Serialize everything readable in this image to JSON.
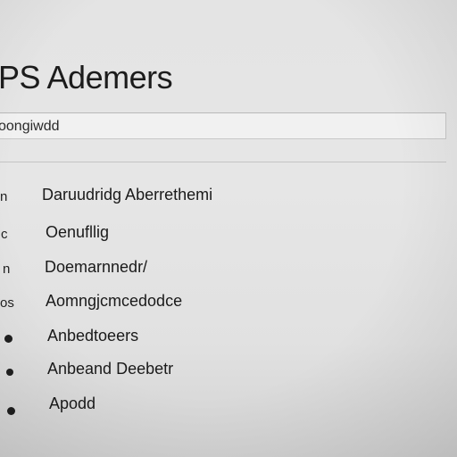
{
  "header": {
    "title": "PS Ademers"
  },
  "search": {
    "value": "oongiwdd"
  },
  "menu": {
    "items": [
      {
        "marker": "n",
        "label": "Daruudridg Aberrethemi"
      },
      {
        "marker": "c",
        "label": "Oenufllig"
      },
      {
        "marker": "n",
        "label": "Doemarnnedr/"
      },
      {
        "marker": "os",
        "label": "Aomngjcmcedodce"
      },
      {
        "marker": "",
        "label": "Anbedtoeers"
      },
      {
        "marker": "",
        "label": "Anbeand Deebetr"
      },
      {
        "marker": "",
        "label": "Apodd"
      }
    ]
  }
}
